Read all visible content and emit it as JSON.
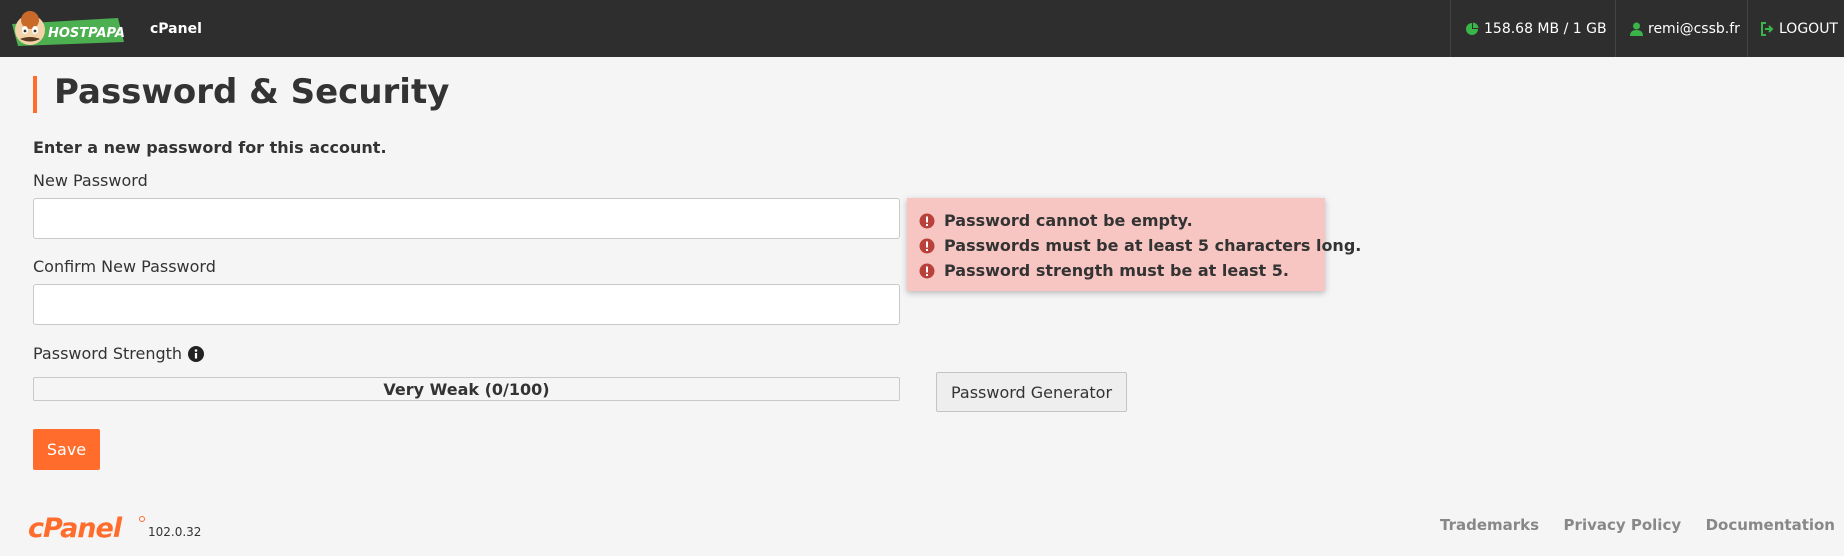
{
  "topbar": {
    "brand_name": "cPanel",
    "disk_usage": "158.68 MB / 1 GB",
    "user": "remi@cssb.fr",
    "logout_label": "LOGOUT",
    "icons": {
      "disk": "pie-chart-icon",
      "user": "user-icon",
      "logout": "logout-icon"
    }
  },
  "page": {
    "title": "Password & Security",
    "intro": "Enter a new password for this account."
  },
  "form": {
    "new_password_label": "New Password",
    "new_password_value": "",
    "confirm_password_label": "Confirm New Password",
    "confirm_password_value": "",
    "strength_label": "Password Strength",
    "strength_text": "Very Weak (0/100)",
    "strength_value": 0,
    "generator_label": "Password Generator",
    "save_label": "Save"
  },
  "validation": {
    "errors": [
      "Password cannot be empty.",
      "Passwords must be at least 5 characters long.",
      "Password strength must be at least 5."
    ]
  },
  "footer": {
    "version": "102.0.32",
    "links": [
      "Trademarks",
      "Privacy Policy",
      "Documentation"
    ]
  },
  "colors": {
    "accent": "#ff6c2c",
    "topbar": "#2e2e2e",
    "icon_green": "#39b54a",
    "error_bg": "#f8c6c2",
    "error_icon": "#b9413b"
  }
}
